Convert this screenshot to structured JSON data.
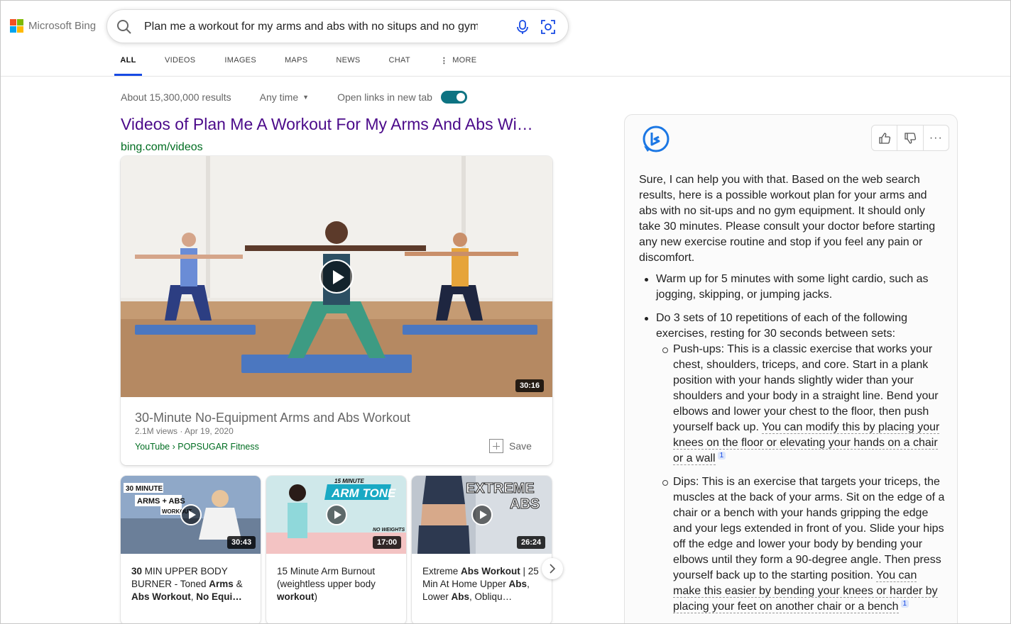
{
  "brand": {
    "name": "Microsoft Bing",
    "colors": [
      "#f25022",
      "#7fba00",
      "#00a4ef",
      "#ffb900"
    ]
  },
  "search": {
    "query": "Plan me a workout for my arms and abs with no situps and no gym"
  },
  "tabs": [
    {
      "label": "ALL",
      "active": true
    },
    {
      "label": "VIDEOS"
    },
    {
      "label": "IMAGES"
    },
    {
      "label": "MAPS"
    },
    {
      "label": "NEWS"
    },
    {
      "label": "CHAT"
    },
    {
      "label": "MORE"
    }
  ],
  "meta": {
    "results": "About 15,300,000 results",
    "time_filter": "Any time",
    "open_links_label": "Open links in new tab",
    "open_links_on": true
  },
  "videos": {
    "title": "Videos of Plan Me A Workout For My Arms And Abs Wi…",
    "url": "bing.com/videos",
    "main": {
      "duration": "30:16",
      "title": "30-Minute No-Equipment Arms and Abs Workout",
      "views_date": "2.1M views · Apr 19, 2020",
      "source": "YouTube › POPSUGAR Fitness",
      "save_label": "Save"
    },
    "small": [
      {
        "duration": "30:43",
        "thumb_text": [
          "30 MINUTE",
          "ARMS + ABS",
          "WORKOUT"
        ],
        "t1": "30",
        "t2": " MIN UPPER BODY BURNER - Toned ",
        "t3": "Arms",
        "t4": " &",
        "t5": "Abs Workout",
        "t6": ", ",
        "t7": "No Equi…"
      },
      {
        "duration": "17:00",
        "thumb_text": [
          "15 MINUTE",
          "ARM TONE",
          "NO WEIGHTS"
        ],
        "t1": "15 Minute Arm Burnout (weightless upper body ",
        "t2": "workout",
        "t3": ")"
      },
      {
        "duration": "26:24",
        "thumb_text": [
          "EXTREME",
          "ABS"
        ],
        "t1": "Extreme ",
        "t2": "Abs Workout",
        "t3": " | 25 Min At Home Upper ",
        "t4": "Abs",
        "t5": ", Lower ",
        "t6": "Abs",
        "t7": ", Obliqu…"
      }
    ]
  },
  "chat": {
    "intro": "Sure, I can help you with that. Based on the web search results, here is a possible workout plan for your arms and abs with no sit-ups and no gym equipment. It should only take 30 minutes. Please consult your doctor before starting any new exercise routine and stop if you feel any pain or discomfort.",
    "bullet1": "Warm up for 5 minutes with some light cardio, such as jogging, skipping, or jumping jacks.",
    "bullet2": "Do 3 sets of 10 repetitions of each of the following exercises, resting for 30 seconds between sets:",
    "pushups": "Push-ups: This is a classic exercise that works your chest, shoulders, triceps, and core. Start in a plank position with your hands slightly wider than your shoulders and your body in a straight line. Bend your elbows and lower your chest to the floor, then push yourself back up. ",
    "pushups_link": "You can modify this by placing your knees on the floor or elevating your hands on a chair or a wall",
    "dips": "Dips: This is an exercise that targets your triceps, the muscles at the back of your arms. Sit on the edge of a chair or a bench with your hands gripping the edge and your legs extended in front of you. Slide your hips off the edge and lower your body by bending your elbows until they form a 90-degree angle. Then press yourself back up to the starting position. ",
    "dips_link": "You can make this easier by bending your knees or harder by placing your feet on another chair or a bench",
    "cite": "1"
  }
}
